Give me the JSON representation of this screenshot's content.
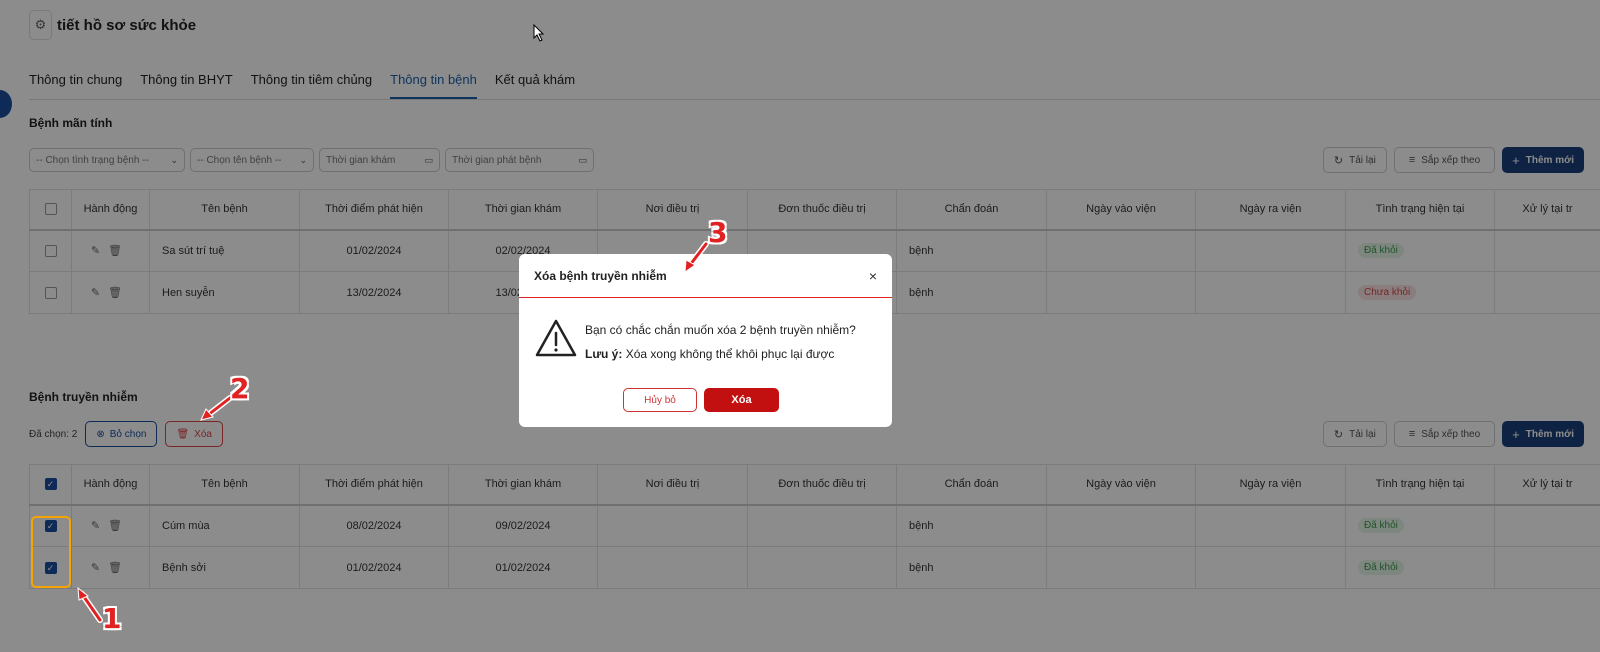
{
  "header": {
    "title": "tiết hồ sơ sức khỏe",
    "icon": "gear-icon"
  },
  "tabs": [
    {
      "label": "Thông tin chung",
      "active": false
    },
    {
      "label": "Thông tin BHYT",
      "active": false
    },
    {
      "label": "Thông tin tiêm chủng",
      "active": false
    },
    {
      "label": "Thông tin bệnh",
      "active": true
    },
    {
      "label": "Kết quả khám",
      "active": false
    }
  ],
  "chronic": {
    "title": "Bệnh mãn tính",
    "filters": {
      "status_placeholder": "-- Chọn tình trạng bệnh --",
      "disease_placeholder": "-- Chọn tên bệnh --",
      "exam_time_placeholder": "Thời gian khám",
      "detect_time_placeholder": "Thời gian phát bệnh"
    },
    "toolbar": {
      "reload": "Tải lại",
      "sort": "Sắp xếp theo",
      "add": "Thêm mới"
    },
    "columns": [
      "Hành động",
      "Tên bệnh",
      "Thời điểm phát hiện",
      "Thời gian khám",
      "Nơi điều trị",
      "Đơn thuốc điều trị",
      "Chẩn đoán",
      "Ngày vào viện",
      "Ngày ra viện",
      "Tình trạng hiện tại",
      "Xử lý tại tr"
    ],
    "rows": [
      {
        "name": "Sa sút trí tuệ",
        "detected": "01/02/2024",
        "exam": "02/02/2024",
        "place": "",
        "prescription": "",
        "diagnosis": "bệnh",
        "admit": "",
        "discharge": "",
        "status": "Đã khỏi",
        "status_type": "ok"
      },
      {
        "name": "Hen suyễn",
        "detected": "13/02/2024",
        "exam": "13/02/2024",
        "place": "",
        "prescription": "",
        "diagnosis": "bệnh",
        "admit": "",
        "discharge": "",
        "status": "Chưa khỏi",
        "status_type": "no"
      }
    ]
  },
  "infectious": {
    "title": "Bệnh truyền nhiễm",
    "selection": {
      "selected_text": "Đã chọn: 2",
      "deselect": "Bỏ chọn",
      "delete": "Xóa"
    },
    "toolbar": {
      "reload": "Tải lại",
      "sort": "Sắp xếp theo",
      "add": "Thêm mới"
    },
    "columns": [
      "Hành động",
      "Tên bệnh",
      "Thời điểm phát hiện",
      "Thời gian khám",
      "Nơi điều trị",
      "Đơn thuốc điều trị",
      "Chẩn đoán",
      "Ngày vào viện",
      "Ngày ra viện",
      "Tình trạng hiện tại",
      "Xử lý tại tr"
    ],
    "rows": [
      {
        "name": "Cúm mùa",
        "detected": "08/02/2024",
        "exam": "09/02/2024",
        "place": "",
        "prescription": "",
        "diagnosis": "bệnh",
        "admit": "",
        "discharge": "",
        "status": "Đã khỏi",
        "status_type": "ok",
        "checked": true
      },
      {
        "name": "Bệnh sởi",
        "detected": "01/02/2024",
        "exam": "01/02/2024",
        "place": "",
        "prescription": "",
        "diagnosis": "bệnh",
        "admit": "",
        "discharge": "",
        "status": "Đã khỏi",
        "status_type": "ok",
        "checked": true
      }
    ]
  },
  "modal": {
    "title": "Xóa bệnh truyền nhiễm",
    "close": "×",
    "question": "Bạn có chắc chắn muốn xóa 2 bệnh truyền nhiễm?",
    "note_label": "Lưu ý:",
    "note_text": "Xóa xong không thể khôi phục lại được",
    "cancel": "Hủy bỏ",
    "confirm": "Xóa"
  },
  "annotations": {
    "step1": "1",
    "step2": "2",
    "step3": "3"
  },
  "colors": {
    "primary": "#1a3f7a",
    "danger": "#c20f0f",
    "highlight": "#f5a400",
    "arrow": "#e02222"
  }
}
